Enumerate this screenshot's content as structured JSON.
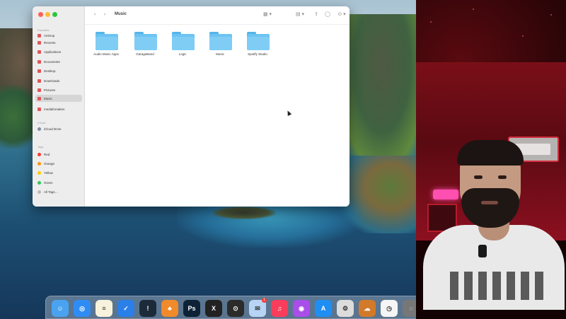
{
  "finder": {
    "title": "Music",
    "sidebar": {
      "favorites_header": "Favorites",
      "items": [
        {
          "label": "AirDrop"
        },
        {
          "label": "Recents"
        },
        {
          "label": "Applications"
        },
        {
          "label": "Documents"
        },
        {
          "label": "Desktop"
        },
        {
          "label": "Downloads"
        },
        {
          "label": "Pictures"
        },
        {
          "label": "Music",
          "selected": true
        },
        {
          "label": "mediaforsaken"
        }
      ],
      "icloud_header": "iCloud",
      "icloud_items": [
        {
          "label": "iCloud Drive"
        }
      ],
      "tags_header": "Tags",
      "tags": [
        {
          "label": "Red",
          "color": "#ff3b30"
        },
        {
          "label": "Orange",
          "color": "#ff9500"
        },
        {
          "label": "Yellow",
          "color": "#ffcc00"
        },
        {
          "label": "Green",
          "color": "#34c759"
        },
        {
          "label": "All Tags…",
          "color": "#bbbbbb"
        }
      ]
    },
    "toolbar": {
      "back_icon": "chevron-left-icon",
      "forward_icon": "chevron-right-icon",
      "view_icon": "grid-icon",
      "share_icon": "share-icon",
      "tag_icon": "tag-icon",
      "action_icon": "ellipsis-icon"
    },
    "folders": [
      {
        "name": "Audio Music Apps"
      },
      {
        "name": "GarageBand"
      },
      {
        "name": "Logic"
      },
      {
        "name": "Music"
      },
      {
        "name": "Spotify Studio"
      }
    ]
  },
  "dock": {
    "apps": [
      {
        "name": "Finder",
        "color": "#4aa3f0",
        "glyph": "☺"
      },
      {
        "name": "Safari",
        "color": "#2f8cf5",
        "glyph": "◎"
      },
      {
        "name": "Notes",
        "color": "#f7f2dc",
        "glyph": "≡"
      },
      {
        "name": "Tasks",
        "color": "#2a7fe8",
        "glyph": "✓"
      },
      {
        "name": "Exclaim",
        "color": "#1c2b3a",
        "glyph": "!"
      },
      {
        "name": "FL Studio",
        "color": "#f08a2b",
        "glyph": "♣"
      },
      {
        "name": "Photoshop",
        "color": "#0d2236",
        "glyph": "Ps"
      },
      {
        "name": "Xcode",
        "color": "#222222",
        "glyph": "X"
      },
      {
        "name": "Utility",
        "color": "#2b2b2b",
        "glyph": "⊙"
      },
      {
        "name": "Messages",
        "color": "#b8d4f5",
        "glyph": "✉",
        "badge": "1"
      },
      {
        "name": "Music",
        "color": "#fa3d5a",
        "glyph": "♫"
      },
      {
        "name": "Podcasts",
        "color": "#a94ee8",
        "glyph": "◉"
      },
      {
        "name": "App Store",
        "color": "#1f8ef2",
        "glyph": "A"
      },
      {
        "name": "Settings",
        "color": "#dcdcdc",
        "glyph": "⚙"
      },
      {
        "name": "Cloud",
        "color": "#d27a2a",
        "glyph": "☁"
      },
      {
        "name": "Clock",
        "color": "#f5f5f5",
        "glyph": "◷"
      },
      {
        "name": "Disk",
        "color": "#777777",
        "glyph": "◌"
      }
    ]
  }
}
